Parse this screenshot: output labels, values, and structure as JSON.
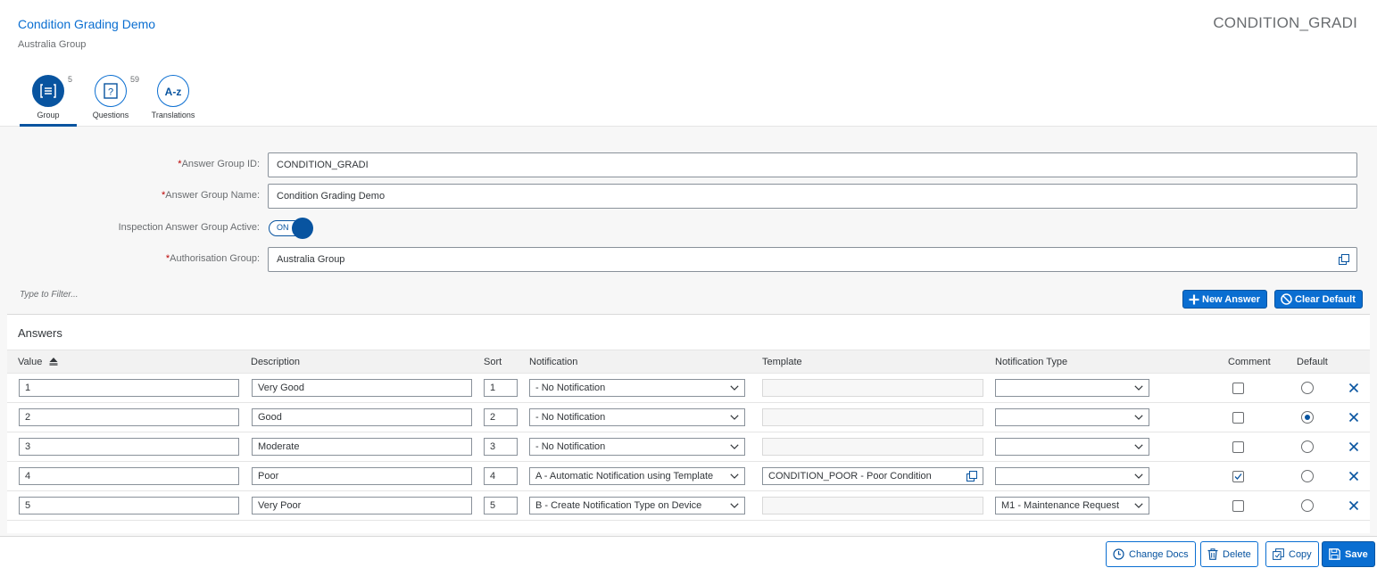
{
  "header": {
    "title": "Condition Grading Demo",
    "subtitle": "Australia Group",
    "object_id": "CONDITION_GRADI"
  },
  "tabs": [
    {
      "label": "Group",
      "count": "5",
      "icon": "list-icon",
      "active": true
    },
    {
      "label": "Questions",
      "count": "59",
      "icon": "question-icon",
      "active": false
    },
    {
      "label": "Translations",
      "count": "",
      "icon": "a-z-icon",
      "active": false
    }
  ],
  "form": {
    "answer_group_id": {
      "label": "Answer Group ID:",
      "value": "CONDITION_GRADI",
      "required": true
    },
    "answer_group_name": {
      "label": "Answer Group Name:",
      "value": "Condition Grading Demo",
      "required": true
    },
    "active": {
      "label": "Inspection Answer Group Active:",
      "state": "ON"
    },
    "authorisation_group": {
      "label": "Authorisation Group:",
      "value": "Australia Group",
      "required": true
    }
  },
  "toolbar": {
    "filter_placeholder": "Type to Filter...",
    "new_answer_label": "New Answer",
    "clear_default_label": "Clear Default"
  },
  "table": {
    "title": "Answers",
    "columns": {
      "value": "Value",
      "description": "Description",
      "sort": "Sort",
      "notification": "Notification",
      "template": "Template",
      "notification_type": "Notification Type",
      "comment": "Comment",
      "default": "Default"
    },
    "rows": [
      {
        "value": "1",
        "description": "Very Good",
        "sort": "1",
        "notification": "- No Notification",
        "template": "",
        "notification_type": "",
        "comment": false,
        "default": false
      },
      {
        "value": "2",
        "description": "Good",
        "sort": "2",
        "notification": "- No Notification",
        "template": "",
        "notification_type": "",
        "comment": false,
        "default": true
      },
      {
        "value": "3",
        "description": "Moderate",
        "sort": "3",
        "notification": "- No Notification",
        "template": "",
        "notification_type": "",
        "comment": false,
        "default": false
      },
      {
        "value": "4",
        "description": "Poor",
        "sort": "4",
        "notification": "A - Automatic Notification using Template",
        "template": "CONDITION_POOR - Poor Condition",
        "notification_type": "",
        "comment": true,
        "default": false
      },
      {
        "value": "5",
        "description": "Very Poor",
        "sort": "5",
        "notification": "B - Create Notification Type on Device",
        "template": "",
        "notification_type": "M1 - Maintenance Request",
        "comment": false,
        "default": false
      }
    ]
  },
  "footer": {
    "change_docs_label": "Change Docs",
    "delete_label": "Delete",
    "copy_label": "Copy",
    "save_label": "Save"
  },
  "colors": {
    "brand": "#0a6ed1",
    "brand_dark": "#0854a0",
    "required": "#bb0000"
  }
}
